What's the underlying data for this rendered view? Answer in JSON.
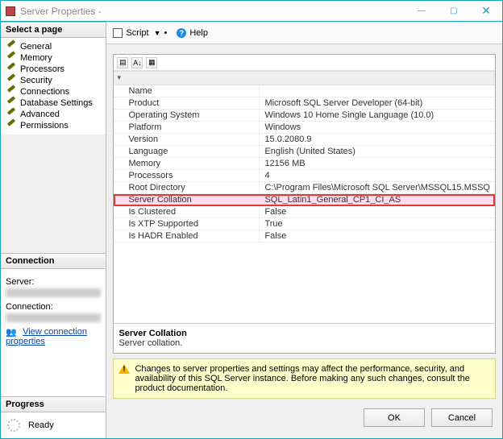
{
  "window": {
    "title": "Server Properties -"
  },
  "nav": {
    "header": "Select a page",
    "items": [
      {
        "label": "General"
      },
      {
        "label": "Memory"
      },
      {
        "label": "Processors"
      },
      {
        "label": "Security"
      },
      {
        "label": "Connections"
      },
      {
        "label": "Database Settings"
      },
      {
        "label": "Advanced"
      },
      {
        "label": "Permissions"
      }
    ]
  },
  "connection": {
    "header": "Connection",
    "server_label": "Server:",
    "connection_label": "Connection:",
    "view_props": "View connection properties"
  },
  "progress": {
    "header": "Progress",
    "status": "Ready"
  },
  "toolbar": {
    "script": "Script",
    "help": "Help"
  },
  "grid": {
    "rows": [
      {
        "k": "Name",
        "v": ""
      },
      {
        "k": "Product",
        "v": "Microsoft SQL Server Developer (64-bit)"
      },
      {
        "k": "Operating System",
        "v": "Windows 10 Home Single Language (10.0)"
      },
      {
        "k": "Platform",
        "v": "Windows"
      },
      {
        "k": "Version",
        "v": "15.0.2080.9"
      },
      {
        "k": "Language",
        "v": "English (United States)"
      },
      {
        "k": "Memory",
        "v": "12156 MB"
      },
      {
        "k": "Processors",
        "v": "4"
      },
      {
        "k": "Root Directory",
        "v": "C:\\Program Files\\Microsoft SQL Server\\MSSQL15.MSSQ"
      },
      {
        "k": "Server Collation",
        "v": "SQL_Latin1_General_CP1_CI_AS"
      },
      {
        "k": "Is Clustered",
        "v": "False"
      },
      {
        "k": "Is XTP Supported",
        "v": "True"
      },
      {
        "k": "Is HADR Enabled",
        "v": "False"
      }
    ],
    "highlight_index": 9
  },
  "description": {
    "name": "Server Collation",
    "value": "Server collation."
  },
  "warning": "Changes to server properties and settings may affect the performance, security, and availability of this SQL Server instance. Before making any such changes, consult the product documentation.",
  "buttons": {
    "ok": "OK",
    "cancel": "Cancel"
  }
}
